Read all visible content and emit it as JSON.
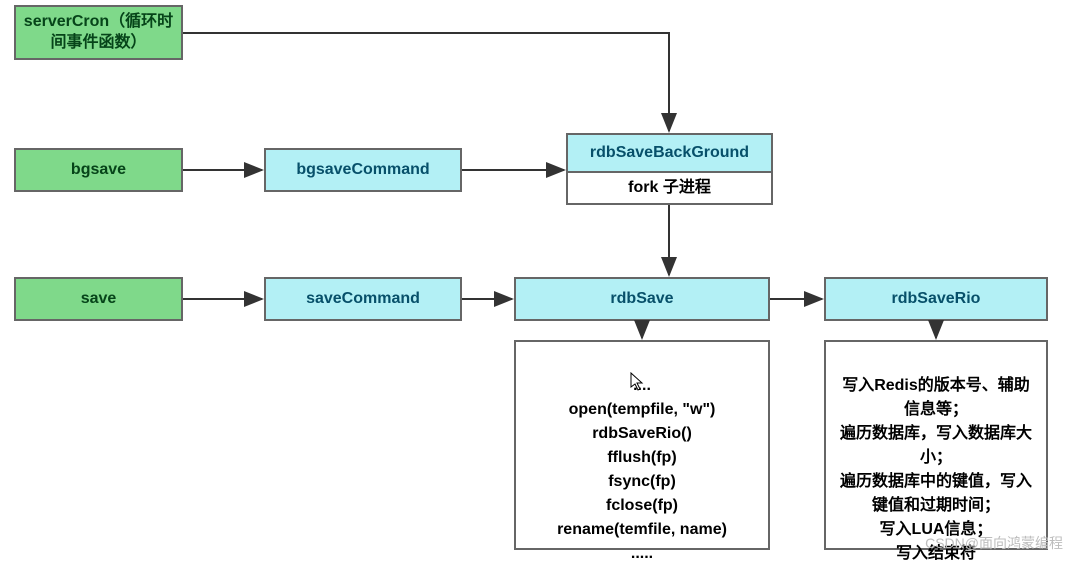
{
  "nodes": {
    "serverCron": "serverCron（循环时间事件函数）",
    "bgsave": "bgsave",
    "bgsaveCommand": "bgsaveCommand",
    "rdbSaveBackGround": "rdbSaveBackGround",
    "fork": "fork 子进程",
    "save": "save",
    "saveCommand": "saveCommand",
    "rdbSave": "rdbSave",
    "rdbSaveRio": "rdbSaveRio",
    "rdbSaveDetails": "....\nopen(tempfile, \"w\")\nrdbSaveRio()\nfflush(fp)\nfsync(fp)\nfclose(fp)\nrename(temfile, name)\n.....",
    "rdbSaveRioDetails": "写入Redis的版本号、辅助信息等；\n遍历数据库，写入数据库大小；\n遍历数据库中的键值，写入键值和过期时间；\n写入LUA信息；\n写入结束符"
  },
  "watermark": "CSDN@面向鸿蒙编程"
}
